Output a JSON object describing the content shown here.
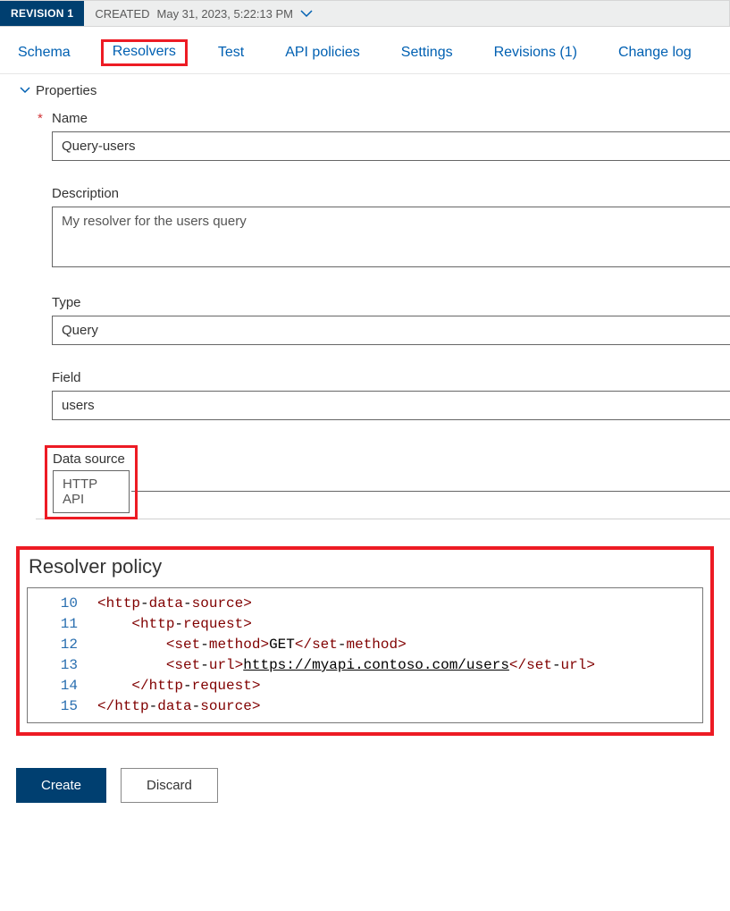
{
  "revision": {
    "badge": "REVISION 1",
    "created_prefix": "CREATED",
    "created_value": "May 31, 2023, 5:22:13 PM"
  },
  "tabs": {
    "schema": "Schema",
    "resolvers": "Resolvers",
    "test": "Test",
    "api_policies": "API policies",
    "settings": "Settings",
    "revisions": "Revisions (1)",
    "change_log": "Change log",
    "active": "resolvers"
  },
  "section": {
    "properties_label": "Properties"
  },
  "form": {
    "name": {
      "label": "Name",
      "value": "Query-users",
      "required": true
    },
    "description": {
      "label": "Description",
      "value": "My resolver for the users query"
    },
    "type": {
      "label": "Type",
      "value": "Query"
    },
    "field": {
      "label": "Field",
      "value": "users"
    },
    "data_source": {
      "label": "Data source",
      "value": "HTTP API"
    }
  },
  "policy": {
    "title": "Resolver policy",
    "lines": [
      {
        "n": 10,
        "indent": 0,
        "kind": "open",
        "tag": "http-data-source"
      },
      {
        "n": 11,
        "indent": 1,
        "kind": "open",
        "tag": "http-request"
      },
      {
        "n": 12,
        "indent": 2,
        "kind": "leaf",
        "tag": "set-method",
        "text": "GET"
      },
      {
        "n": 13,
        "indent": 2,
        "kind": "leaf",
        "tag": "set-url",
        "text": "https://myapi.contoso.com/users",
        "underline": true
      },
      {
        "n": 14,
        "indent": 1,
        "kind": "close",
        "tag": "http-request"
      },
      {
        "n": 15,
        "indent": 0,
        "kind": "close",
        "tag": "http-data-source"
      }
    ]
  },
  "buttons": {
    "create": "Create",
    "discard": "Discard"
  }
}
